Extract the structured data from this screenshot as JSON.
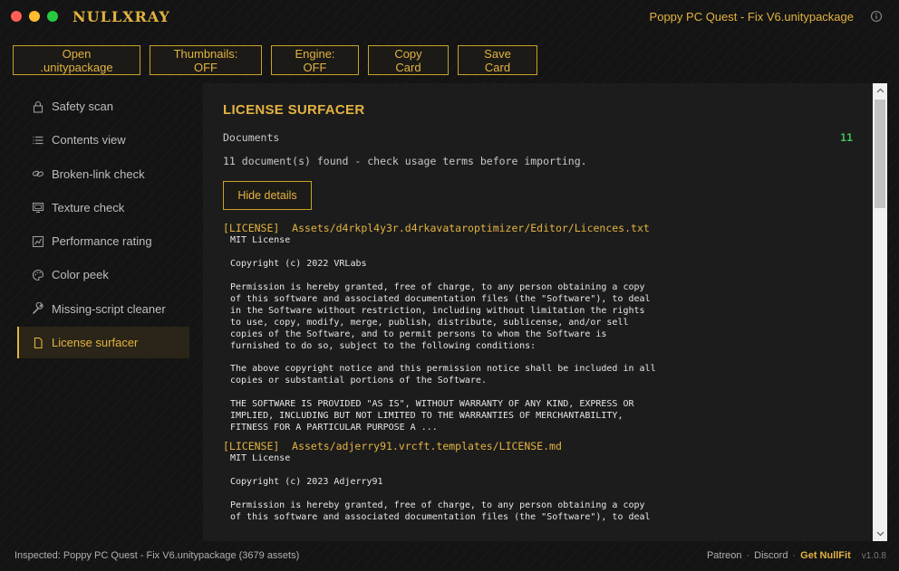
{
  "app": {
    "title": "NULLXRAY",
    "window_file": "Poppy PC Quest - Fix V6.unitypackage"
  },
  "toolbar": {
    "open_label": "Open .unitypackage",
    "thumbnails_label": "Thumbnails: OFF",
    "engine_label": "Engine: OFF",
    "copy_card_label": "Copy Card",
    "save_card_label": "Save Card"
  },
  "sidebar": {
    "items": [
      {
        "label": "Safety scan",
        "icon": "lock-icon"
      },
      {
        "label": "Contents view",
        "icon": "list-icon"
      },
      {
        "label": "Broken-link check",
        "icon": "link-icon"
      },
      {
        "label": "Texture check",
        "icon": "monitor-icon"
      },
      {
        "label": "Performance rating",
        "icon": "chart-icon"
      },
      {
        "label": "Color peek",
        "icon": "palette-icon"
      },
      {
        "label": "Missing-script cleaner",
        "icon": "wrench-icon"
      },
      {
        "label": "License surfacer",
        "icon": "document-icon",
        "active": true
      }
    ]
  },
  "panel": {
    "title": "LICENSE SURFACER",
    "docs_label": "Documents",
    "docs_count": "11",
    "docs_note": "11 document(s) found - check usage terms before importing.",
    "hide_details_label": "Hide details",
    "documents": [
      {
        "header": "[LICENSE]  Assets/d4rkpl4y3r.d4rkavataroptimizer/Editor/Licences.txt",
        "body": "MIT License\n\nCopyright (c) 2022 VRLabs\n\nPermission is hereby granted, free of charge, to any person obtaining a copy\nof this software and associated documentation files (the \"Software\"), to deal\nin the Software without restriction, including without limitation the rights\nto use, copy, modify, merge, publish, distribute, sublicense, and/or sell\ncopies of the Software, and to permit persons to whom the Software is\nfurnished to do so, subject to the following conditions:\n\nThe above copyright notice and this permission notice shall be included in all\ncopies or substantial portions of the Software.\n\nTHE SOFTWARE IS PROVIDED \"AS IS\", WITHOUT WARRANTY OF ANY KIND, EXPRESS OR\nIMPLIED, INCLUDING BUT NOT LIMITED TO THE WARRANTIES OF MERCHANTABILITY,\nFITNESS FOR A PARTICULAR PURPOSE A ..."
      },
      {
        "header": "[LICENSE]  Assets/adjerry91.vrcft.templates/LICENSE.md",
        "body": "MIT License\n\nCopyright (c) 2023 Adjerry91\n\nPermission is hereby granted, free of charge, to any person obtaining a copy\nof this software and associated documentation files (the \"Software\"), to deal"
      }
    ]
  },
  "status": {
    "inspected": "Inspected: Poppy PC Quest - Fix V6.unitypackage  (3679 assets)",
    "patreon": "Patreon",
    "discord": "Discord",
    "get_nullfit": "Get NullFit",
    "version": "v1.0.8"
  },
  "colors": {
    "accent": "#e3b341",
    "background": "#141414",
    "panel": "#1c1c1c",
    "count_green": "#3fbf5f"
  }
}
